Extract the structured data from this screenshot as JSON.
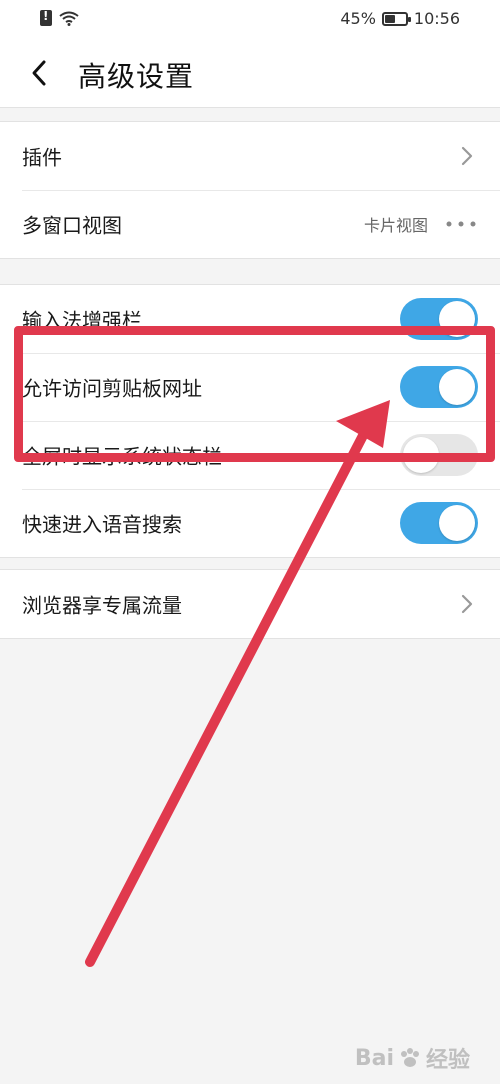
{
  "status_bar": {
    "battery_percent": "45%",
    "time": "10:56",
    "battery_level": 0.45
  },
  "header": {
    "title": "高级设置"
  },
  "group1": [
    {
      "label": "插件"
    },
    {
      "label": "多窗口视图",
      "value": "卡片视图"
    }
  ],
  "group2": [
    {
      "label": "输入法增强栏",
      "toggle": true
    },
    {
      "label": "允许访问剪贴板网址",
      "toggle": true
    },
    {
      "label": "全屏时显示系统状态栏",
      "toggle": false
    },
    {
      "label": "快速进入语音搜索",
      "toggle": true
    }
  ],
  "group3": [
    {
      "label": "浏览器享专属流量"
    }
  ],
  "watermark": {
    "text": "经验"
  },
  "colors": {
    "accent": "#3fa7e6",
    "annotation": "#e0394d",
    "toggle_off": "#e6e6e6"
  }
}
